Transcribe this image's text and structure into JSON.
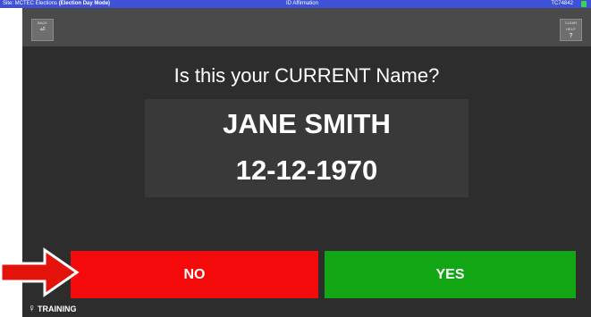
{
  "status_bar": {
    "site_prefix": "Site: MCTEC Elections ",
    "mode": "(Election Day Mode)",
    "title": "ID Affirmation",
    "device_code": "TC74842"
  },
  "toolbar": {
    "back_label": "BACK",
    "back_glyph": "⏎",
    "help_label": "CLEAR HELP",
    "help_glyph": "?"
  },
  "prompt": {
    "question": "Is this your CURRENT Name?",
    "name": "JANE SMITH",
    "dob": "12-12-1970"
  },
  "buttons": {
    "no_label": "NO",
    "yes_label": "YES"
  },
  "footer": {
    "training_label": "TRAINING"
  },
  "colors": {
    "status_bar": "#3f51d8",
    "toolbar": "#4a4a4a",
    "background": "#2d2d2d",
    "no_button": "#f40a0a",
    "yes_button": "#12a514",
    "annotation_arrow": "#e3120b"
  }
}
